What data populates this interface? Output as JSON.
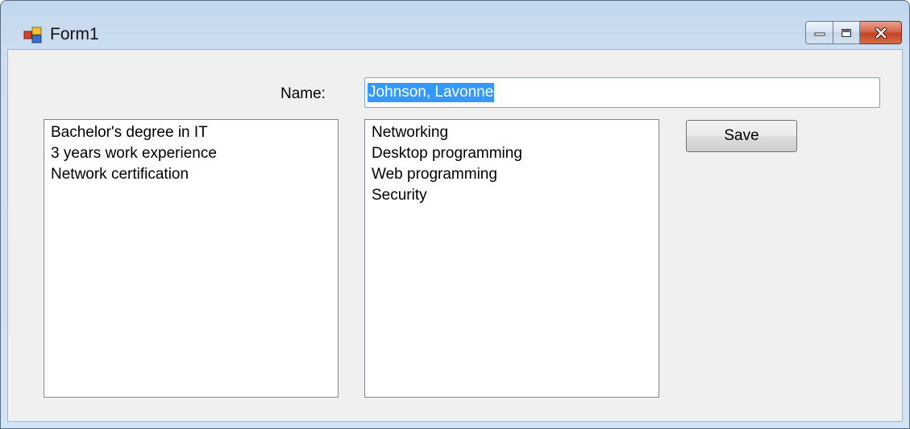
{
  "window": {
    "title": "Form1"
  },
  "icons": {
    "app": "form-app-icon",
    "minimize": "minimize-icon",
    "maximize": "maximize-icon",
    "close": "close-icon"
  },
  "form": {
    "name_label": "Name:",
    "name_value": "Johnson, Lavonne",
    "save_label": "Save"
  },
  "qualifications": [
    "Bachelor's degree in IT",
    "3 years work experience",
    "Network certification"
  ],
  "skills": [
    "Networking",
    "Desktop programming",
    "Web programming",
    "Security"
  ],
  "colors": {
    "selection": "#3399ff",
    "close_button": "#c2421f",
    "client_background": "#f0f0f0"
  }
}
